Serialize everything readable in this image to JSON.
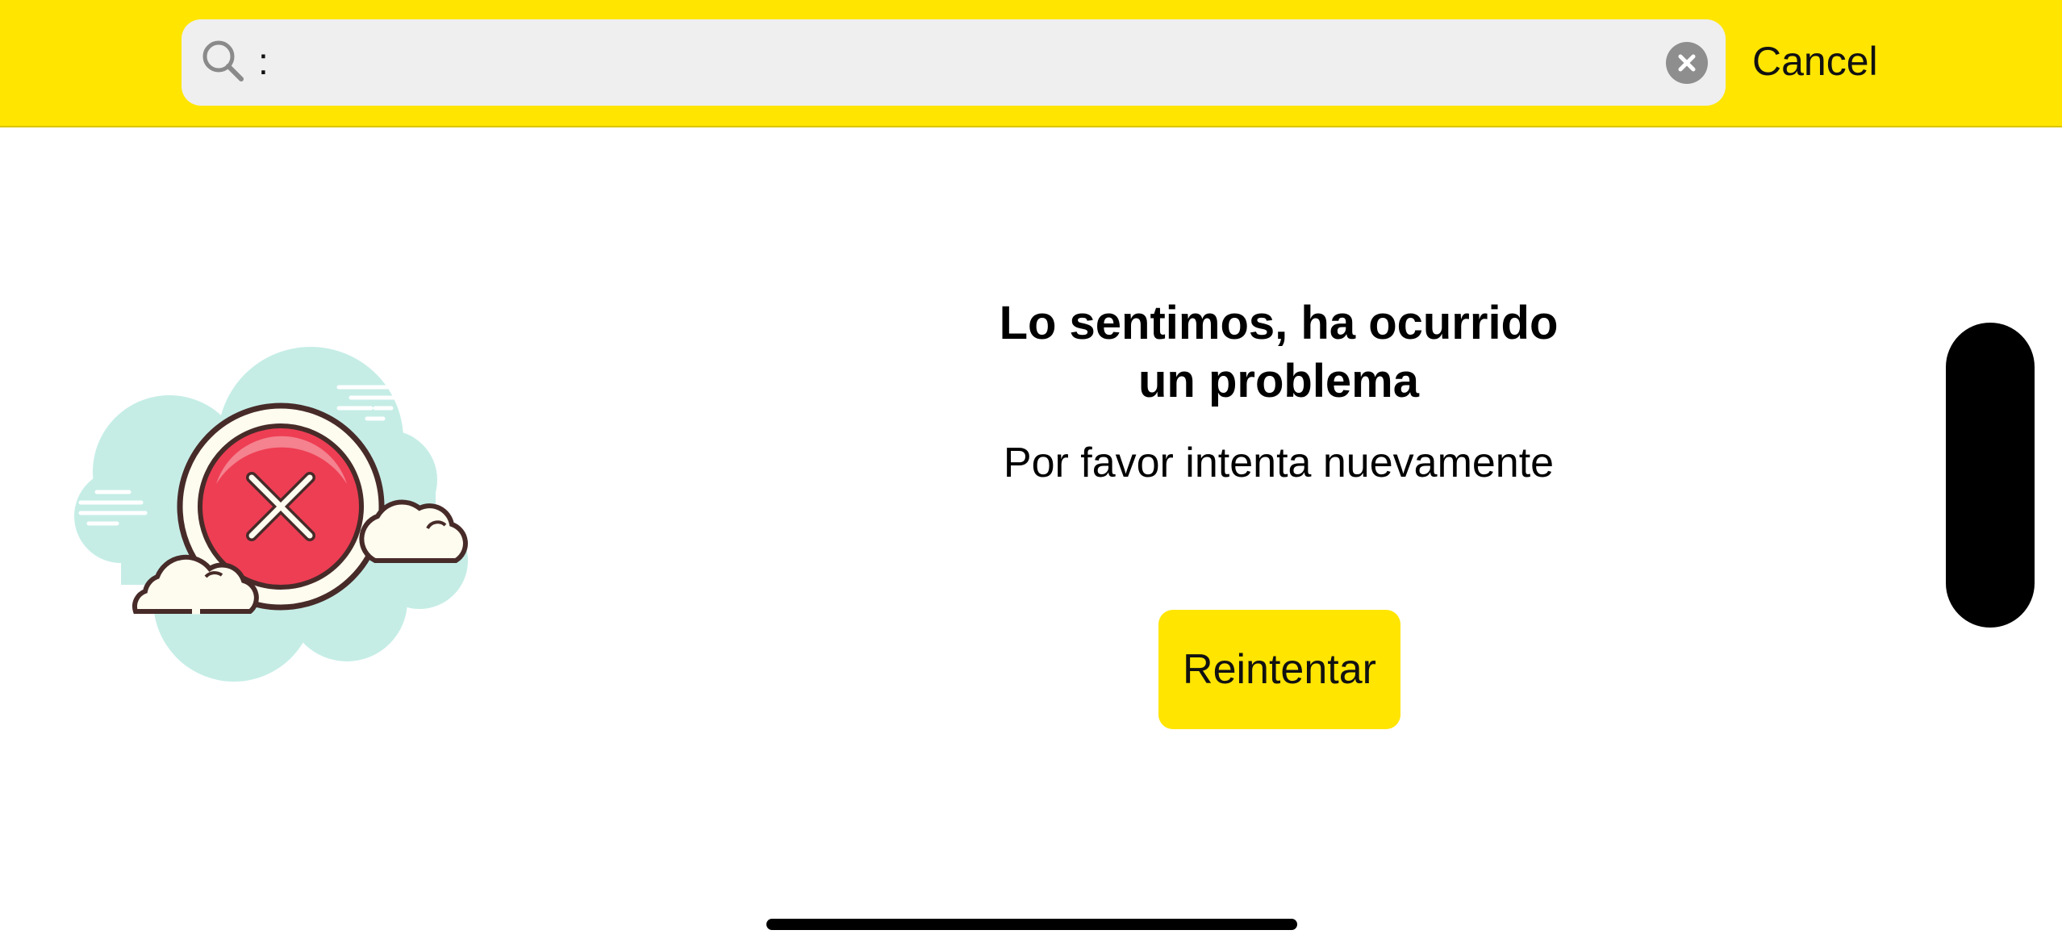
{
  "search": {
    "value": ":",
    "cancel_label": "Cancel"
  },
  "error": {
    "title_line1": "Lo sentimos, ha ocurrido",
    "title_line2": "un problema",
    "subtitle": "Por favor intenta nuevamente",
    "retry_label": "Reintentar"
  },
  "icons": {
    "search": "search-icon",
    "clear": "clear-icon",
    "illustration": "error-cloud-icon"
  },
  "colors": {
    "accent_yellow": "#FFE500",
    "search_field_bg": "#EFEFEF",
    "error_red": "#EE3E54",
    "cloud_teal": "#C5EDE6"
  }
}
